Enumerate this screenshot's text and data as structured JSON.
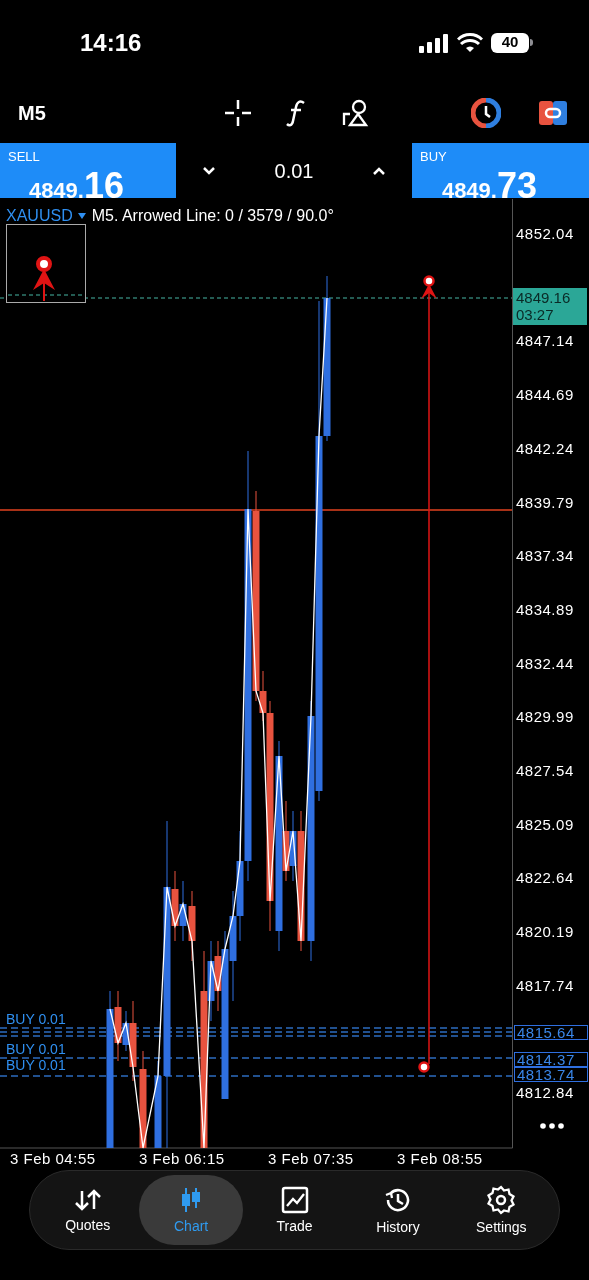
{
  "status_bar": {
    "time": "14:16",
    "battery": "40"
  },
  "toolbar": {
    "timeframe": "M5"
  },
  "trade_panel": {
    "sell": {
      "label": "SELL",
      "price_main": "4849.",
      "price_big": "16"
    },
    "volume": "0.01",
    "buy": {
      "label": "BUY",
      "price_main": "4849.",
      "price_big": "73"
    }
  },
  "chart": {
    "symbol": "XAUUSD",
    "info": "M5. Arrowed Line: 0 / 3579 / 90.0°",
    "price_labels": [
      "4852.04",
      "4847.14",
      "4844.69",
      "4842.24",
      "4839.79",
      "4837.34",
      "4834.89",
      "4832.44",
      "4829.99",
      "4827.54",
      "4825.09",
      "4822.64",
      "4820.19",
      "4817.74",
      "4812.84"
    ],
    "current_price": {
      "price": "4849.16",
      "countdown": "03:27"
    },
    "order_levels": [
      "4815.64",
      "4814.37",
      "4813.74"
    ],
    "order_labels": [
      "BUY 0.01",
      "BUY 0.01",
      "BUY 0.01"
    ],
    "time_labels": [
      "3 Feb 04:55",
      "3 Feb 06:15",
      "3 Feb 07:35",
      "3 Feb 08:55"
    ]
  },
  "nav": [
    {
      "label": "Quotes",
      "selected": false
    },
    {
      "label": "Chart",
      "selected": true
    },
    {
      "label": "Trade",
      "selected": false
    },
    {
      "label": "History",
      "selected": false
    },
    {
      "label": "Settings",
      "selected": false
    }
  ]
}
